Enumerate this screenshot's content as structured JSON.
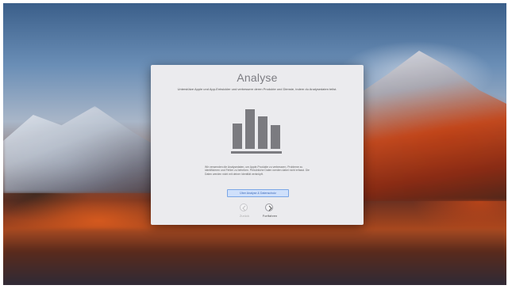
{
  "dialog": {
    "title": "Analyse",
    "subtitle": "Unterstütze Apple und App-Entwickler und verbessere deren Produkte und Dienste, indem du Analysedaten teilst.",
    "body": "Wir verwenden die Analysedaten, um Apple-Produkte zu verbessern, Probleme zu identifizieren und Fehler zu beheben. Persönliche Daten werden dabei nicht erfasst. Die Daten werden nicht mit deiner Identität verknüpft.",
    "link_label": "Über Analyse & Datenschutz",
    "back_label": "Zurück",
    "continue_label": "Fortfahren"
  },
  "colors": {
    "dialog_bg": "#ebebee",
    "link_bg": "#cfe0fb",
    "link_text": "#3a67b8",
    "chart_bars": "#7b7b80"
  },
  "icons": {
    "chart": "bar-chart-icon",
    "back": "arrow-left-icon",
    "continue": "arrow-right-icon"
  }
}
